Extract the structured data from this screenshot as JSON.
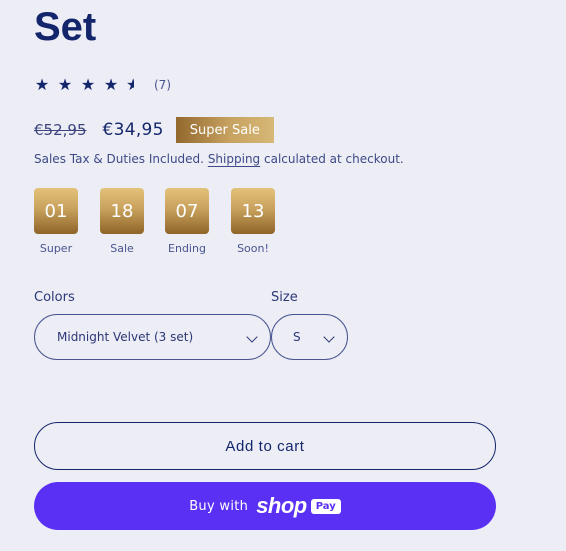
{
  "product": {
    "title": "Set",
    "rating": {
      "stars": 4.5,
      "count_label": "(7)"
    },
    "price": {
      "old": "€52,95",
      "new": "€34,95",
      "badge": "Super Sale"
    },
    "tax_note": {
      "before": "Sales Tax & Duties Included. ",
      "link": "Shipping",
      "after": " calculated at checkout."
    }
  },
  "countdown": [
    {
      "value": "01",
      "label": "Super"
    },
    {
      "value": "18",
      "label": "Sale"
    },
    {
      "value": "07",
      "label": "Ending"
    },
    {
      "value": "13",
      "label": "Soon!"
    }
  ],
  "options": {
    "colors": {
      "label": "Colors",
      "value": "Midnight Velvet (3 set)"
    },
    "size": {
      "label": "Size",
      "value": "S"
    }
  },
  "actions": {
    "add_to_cart": "Add to cart",
    "buy_with": "Buy with",
    "shop_word": "shop",
    "pay_badge": "Pay"
  },
  "colors": {
    "navy": "#14266b",
    "shop_pay_purple": "#5a31f4",
    "gold": "#c7a261",
    "background": "#ecedf5"
  },
  "icons": {
    "star": "star-icon",
    "half_star": "half-star-icon",
    "chevron": "chevron-down-icon"
  }
}
